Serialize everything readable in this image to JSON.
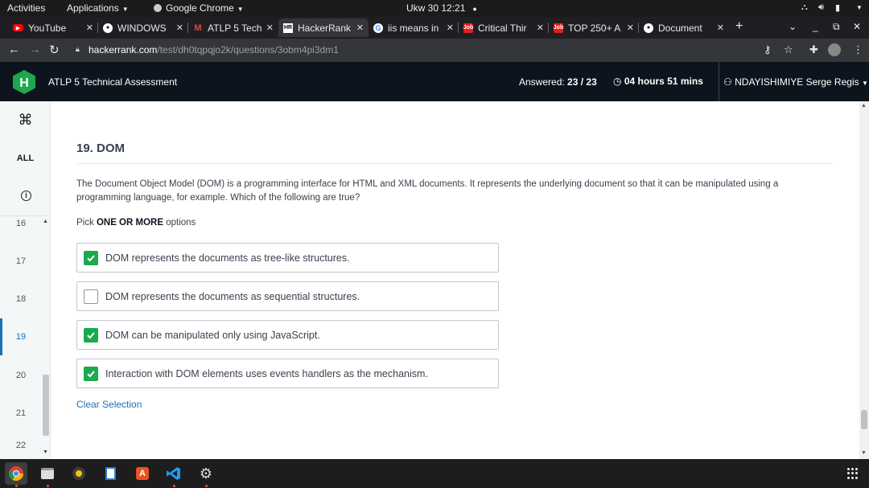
{
  "system": {
    "activities": "Activities",
    "applications": "Applications",
    "active_app": "Google Chrome",
    "clock": "Ukw 30  12:21"
  },
  "tabs": [
    {
      "title": "YouTube",
      "icon": "youtube-icon"
    },
    {
      "title": "WINDOWS",
      "icon": "github-icon"
    },
    {
      "title": "ATLP 5 Tech",
      "icon": "gmail-icon"
    },
    {
      "title": "HackerRank",
      "icon": "hackerrank-icon",
      "active": true
    },
    {
      "title": "iis means in",
      "icon": "google-icon"
    },
    {
      "title": "Critical Thir",
      "icon": "job-icon"
    },
    {
      "title": "TOP 250+ A",
      "icon": "job-icon"
    },
    {
      "title": "Document",
      "icon": "github-icon"
    }
  ],
  "address": {
    "host": "hackerrank.com",
    "path": "/test/dh0tqpqjo2k/questions/3obm4pi3dm1"
  },
  "header": {
    "title": "ATLP 5 Technical Assessment",
    "answered_label": "Answered:",
    "answered_value": "23 / 23",
    "timer": "04 hours 51 mins",
    "user": "NDAYISHIMIYE Serge Regis"
  },
  "rail": {
    "all_label": "ALL",
    "questions": [
      "16",
      "17",
      "18",
      "19",
      "20",
      "21",
      "22"
    ],
    "current": "19"
  },
  "question": {
    "title": "19. DOM",
    "text": "The Document Object Model (DOM) is a programming interface for HTML and XML documents. It represents the underlying document so that it can be manipulated using a programming language, for example. Which of the following are true?",
    "pick_prefix": "Pick",
    "pick_bold": "ONE OR MORE",
    "pick_suffix": "options",
    "options": [
      {
        "label": "DOM represents the documents as tree-like structures.",
        "checked": true
      },
      {
        "label": "DOM represents the documents as sequential structures.",
        "checked": false
      },
      {
        "label": "DOM can be manipulated only using JavaScript.",
        "checked": true
      },
      {
        "label": "Interaction with DOM elements uses events handlers as the mechanism.",
        "checked": true
      }
    ],
    "clear_label": "Clear Selection"
  },
  "colors": {
    "accent_green": "#1ba94c",
    "header_bg": "#0e141e",
    "link_blue": "#1f6fb5"
  }
}
